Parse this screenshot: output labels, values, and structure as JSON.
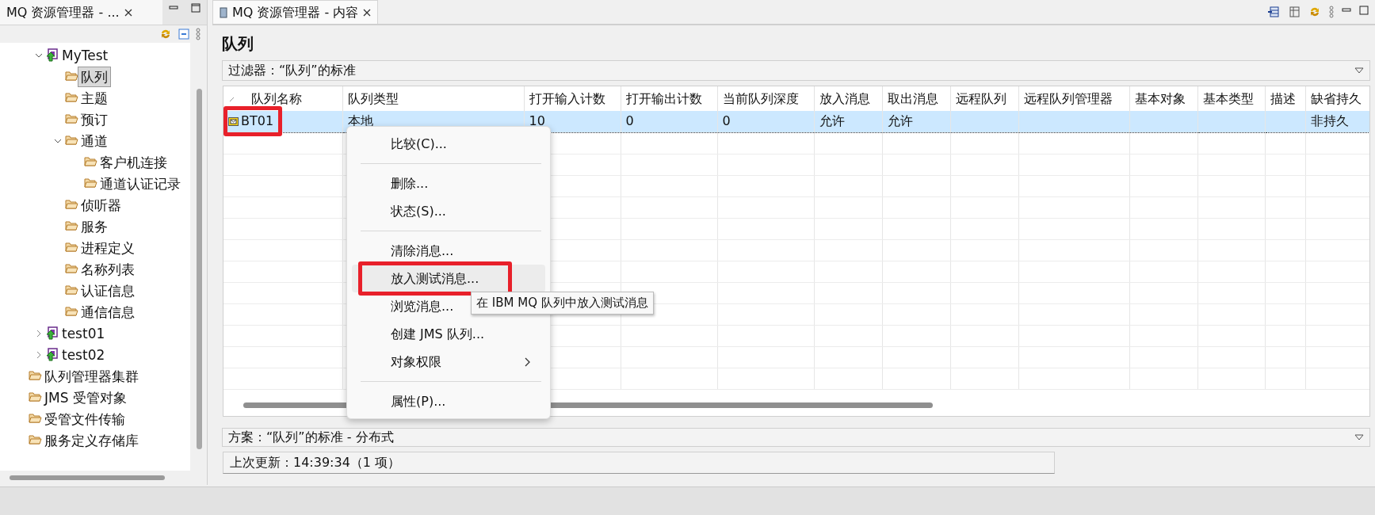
{
  "explorer": {
    "tab_title": "MQ 资源管理器 - ...",
    "tree": [
      {
        "label": "MyTest",
        "kind": "queue-manager",
        "expanded": true,
        "selected": false,
        "children": [
          {
            "label": "队列",
            "kind": "folder",
            "selected": true
          },
          {
            "label": "主题",
            "kind": "folder",
            "selected": false
          },
          {
            "label": "预订",
            "kind": "folder",
            "selected": false
          },
          {
            "label": "通道",
            "kind": "folder",
            "expanded": true,
            "selected": false,
            "children": [
              {
                "label": "客户机连接",
                "kind": "folder",
                "selected": false
              },
              {
                "label": "通道认证记录",
                "kind": "folder",
                "selected": false
              }
            ]
          },
          {
            "label": "侦听器",
            "kind": "folder",
            "selected": false
          },
          {
            "label": "服务",
            "kind": "folder",
            "selected": false
          },
          {
            "label": "进程定义",
            "kind": "folder",
            "selected": false
          },
          {
            "label": "名称列表",
            "kind": "folder",
            "selected": false
          },
          {
            "label": "认证信息",
            "kind": "folder",
            "selected": false
          },
          {
            "label": "通信信息",
            "kind": "folder",
            "selected": false
          }
        ]
      },
      {
        "label": "test01",
        "kind": "queue-manager",
        "expanded": false,
        "selected": false
      },
      {
        "label": "test02",
        "kind": "queue-manager",
        "expanded": false,
        "selected": false
      },
      {
        "label": "队列管理器集群",
        "kind": "folder",
        "selected": false
      },
      {
        "label": "JMS 受管对象",
        "kind": "folder",
        "selected": false
      },
      {
        "label": "受管文件传输",
        "kind": "folder",
        "selected": false
      },
      {
        "label": "服务定义存储库",
        "kind": "folder",
        "selected": false
      }
    ]
  },
  "content": {
    "tab_title": "MQ 资源管理器 - 内容",
    "heading": "队列",
    "filter": "过滤器：“队列”的标准",
    "table": {
      "columns": [
        "队列名称",
        "队列类型",
        "打开输入计数",
        "打开输出计数",
        "当前队列深度",
        "放入消息",
        "取出消息",
        "远程队列",
        "远程队列管理器",
        "基本对象",
        "基本类型",
        "描述",
        "缺省持久"
      ],
      "rows": [
        {
          "selected": true,
          "highlighted": true,
          "cells": [
            "BT01",
            "本地",
            "10",
            "0",
            "0",
            "允许",
            "允许",
            null,
            null,
            null,
            null,
            null,
            "非持久"
          ]
        }
      ]
    },
    "scheme": "方案：“队列”的标准 - 分布式",
    "status": "上次更新：14:39:34（1 项）"
  },
  "context_menu": {
    "items": [
      {
        "kind": "item",
        "label": "比较(C)...",
        "hover": false,
        "highlighted": false
      },
      {
        "kind": "separator"
      },
      {
        "kind": "item",
        "label": "删除...",
        "hover": false,
        "highlighted": false
      },
      {
        "kind": "item",
        "label": "状态(S)...",
        "hover": false,
        "highlighted": false
      },
      {
        "kind": "separator"
      },
      {
        "kind": "item",
        "label": "清除消息...",
        "hover": false,
        "highlighted": false
      },
      {
        "kind": "item",
        "label": "放入测试消息...",
        "hover": true,
        "highlighted": true
      },
      {
        "kind": "item",
        "label": "浏览消息...",
        "hover": false,
        "highlighted": false
      },
      {
        "kind": "item",
        "label": "创建 JMS 队列...",
        "hover": false,
        "highlighted": false
      },
      {
        "kind": "submenu",
        "label": "对象权限",
        "hover": false,
        "highlighted": false
      },
      {
        "kind": "separator"
      },
      {
        "kind": "item",
        "label": "属性(P)...",
        "hover": false,
        "highlighted": false
      }
    ]
  },
  "tooltip": "在 IBM MQ 队列中放入测试消息"
}
